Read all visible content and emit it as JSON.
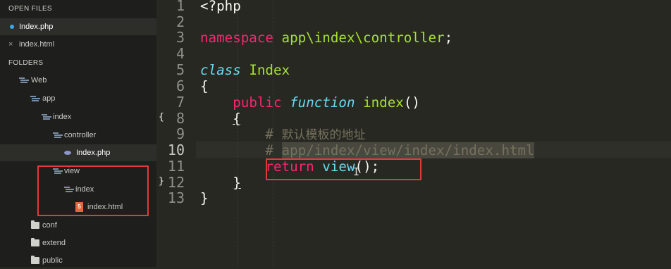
{
  "sidebar": {
    "open_files_header": "OPEN FILES",
    "open_files": [
      {
        "name": "Index.php",
        "status": "modified-dot"
      },
      {
        "name": "index.html",
        "status": "close-x"
      }
    ],
    "close_glyph": "×",
    "folders_header": "FOLDERS",
    "tree": [
      {
        "name": "Web",
        "icon": "folder-open-icon"
      },
      {
        "name": "app",
        "icon": "folder-open-icon"
      },
      {
        "name": "index",
        "icon": "folder-open-icon"
      },
      {
        "name": "controller",
        "icon": "folder-open-icon"
      },
      {
        "name": "Index.php",
        "icon": "php-file-icon"
      },
      {
        "name": "view",
        "icon": "folder-open-icon"
      },
      {
        "name": "index",
        "icon": "folder-open-icon"
      },
      {
        "name": "index.html",
        "icon": "html5-file-icon"
      },
      {
        "name": "conf",
        "icon": "folder-icon"
      },
      {
        "name": "extend",
        "icon": "folder-icon"
      },
      {
        "name": "public",
        "icon": "folder-icon"
      }
    ],
    "html5_badge": "5"
  },
  "editor": {
    "line_numbers": [
      "1",
      "2",
      "3",
      "4",
      "5",
      "6",
      "7",
      "8",
      "9",
      "10",
      "11",
      "12",
      "13"
    ],
    "current_line": "10",
    "fold_markers": {
      "open": "{",
      "close": "}"
    },
    "code": {
      "l1": "<?php",
      "l3_kw": "namespace",
      "l3_ns": "app\\index\\controller",
      "l3_end": ";",
      "l5_kw": "class",
      "l5_name": "Index",
      "l6": "{",
      "l7_kw": "public",
      "l7_fn": "function",
      "l7_name": "index",
      "l7_paren": "()",
      "l8": "{",
      "l9_hash": "#",
      "l9_text": "默认模板的地址",
      "l10_hash": "#",
      "l10_text": "app/index/view/index/index.html",
      "l11_kw": "return",
      "l11_call": "view",
      "l11_end": "();",
      "l12": "}",
      "l13": "}"
    },
    "cursor_glyph": "I"
  },
  "colors": {
    "background": "#272822",
    "sidebar": "#1e1f1c",
    "keyword": "#f92672",
    "function": "#a6e22e",
    "storage": "#66d9ef",
    "comment": "#75715e",
    "annotation_box": "#e03a3a"
  }
}
